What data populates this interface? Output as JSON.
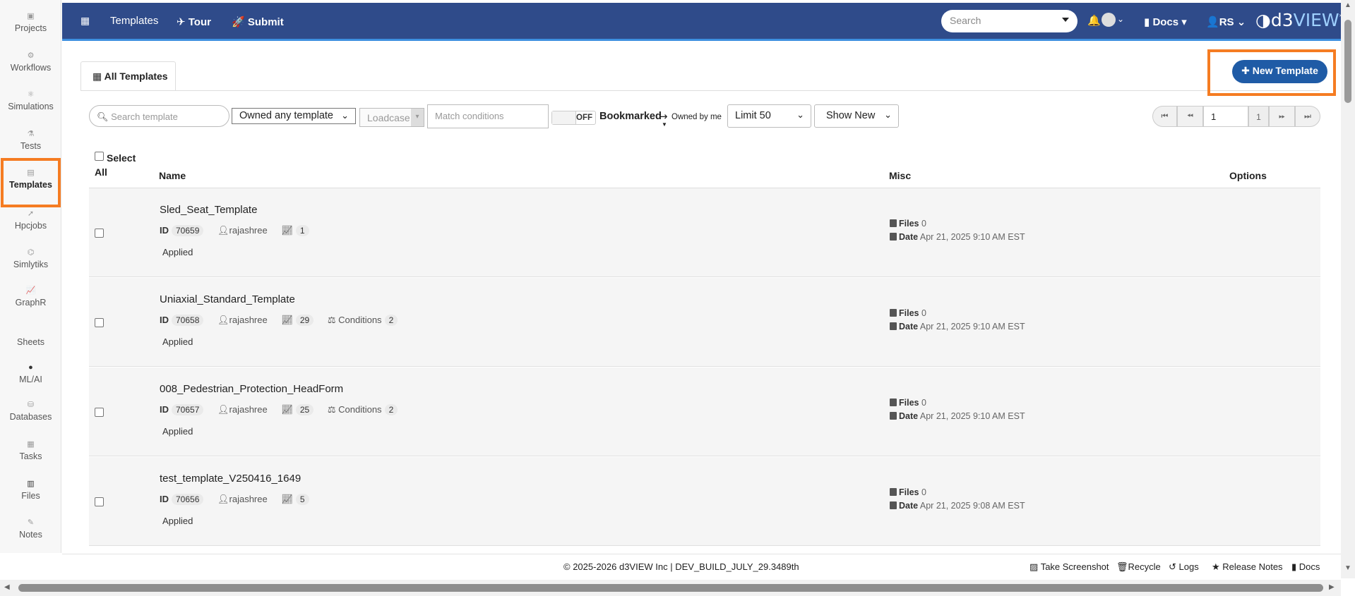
{
  "sidebar": {
    "items": [
      {
        "label": "Projects",
        "icon": "project-icon"
      },
      {
        "label": "Workflows",
        "icon": "workflow-icon"
      },
      {
        "label": "Simulations",
        "icon": "atom-icon"
      },
      {
        "label": "Tests",
        "icon": "flask-icon"
      },
      {
        "label": "Templates",
        "icon": "template-icon",
        "active": true
      },
      {
        "label": "Hpcjobs",
        "icon": "rocket-icon"
      },
      {
        "label": "Simlytiks",
        "icon": "analytics-icon"
      },
      {
        "label": "GraphR",
        "icon": "line-chart-icon"
      },
      {
        "label": "Sheets",
        "icon": "sheet-icon"
      },
      {
        "label": "ML/AI",
        "icon": "brain-icon"
      },
      {
        "label": "Databases",
        "icon": "database-icon"
      },
      {
        "label": "Tasks",
        "icon": "task-icon"
      },
      {
        "label": "Files",
        "icon": "files-icon"
      },
      {
        "label": "Notes",
        "icon": "note-icon"
      }
    ]
  },
  "topbar": {
    "grid_icon": "grid-icon",
    "templates": "Templates",
    "tour": "Tour",
    "submit": "Submit",
    "search_placeholder": "Search",
    "docs": "Docs",
    "user": "RS",
    "logo_d3": "d3",
    "logo_view": "VIEW",
    "logo_star": "*"
  },
  "tabs": {
    "all_templates": "All Templates"
  },
  "actions": {
    "new_template": "New Template"
  },
  "filters": {
    "search_placeholder": "Search template",
    "owner_filter": "Owned any template",
    "loadcase": "Loadcase",
    "match_conditions": "Match conditions",
    "toggle_off": "OFF",
    "bookmarked": "Bookmarked",
    "owned_by_me": "Owned by me",
    "limit": "Limit 50",
    "show": "Show New"
  },
  "pagination": {
    "page": "1",
    "total": "1"
  },
  "table": {
    "select_all": "Select",
    "select_all_2": "All",
    "columns": {
      "name": "Name",
      "misc": "Misc",
      "options": "Options"
    },
    "rows": [
      {
        "name": "Sled_Seat_Template",
        "id": "70659",
        "user": "rajashree",
        "count": "1",
        "conditions": "",
        "status": "Applied",
        "files_label": "Files",
        "files": "0",
        "date_label": "Date",
        "date": "Apr 21, 2025 9:10 AM EST"
      },
      {
        "name": "Uniaxial_Standard_Template",
        "id": "70658",
        "user": "rajashree",
        "count": "29",
        "conditions_label": "Conditions",
        "conditions": "2",
        "status": "Applied",
        "files_label": "Files",
        "files": "0",
        "date_label": "Date",
        "date": "Apr 21, 2025 9:10 AM EST"
      },
      {
        "name": "008_Pedestrian_Protection_HeadForm",
        "id": "70657",
        "user": "rajashree",
        "count": "25",
        "conditions_label": "Conditions",
        "conditions": "2",
        "status": "Applied",
        "files_label": "Files",
        "files": "0",
        "date_label": "Date",
        "date": "Apr 21, 2025 9:10 AM EST"
      },
      {
        "name": "test_template_V250416_1649",
        "id": "70656",
        "user": "rajashree",
        "count": "5",
        "conditions": "",
        "status": "Applied",
        "files_label": "Files",
        "files": "0",
        "date_label": "Date",
        "date": "Apr 21, 2025 9:08 AM EST"
      }
    ],
    "id_label": "ID"
  },
  "footer": {
    "copyright": "© 2025-2026 d3VIEW Inc | DEV_BUILD_JULY_29.3489th",
    "take_screenshot": "Take Screenshot",
    "recycle": "Recycle",
    "logs": "Logs",
    "release_notes": "Release Notes",
    "docs": "Docs"
  }
}
